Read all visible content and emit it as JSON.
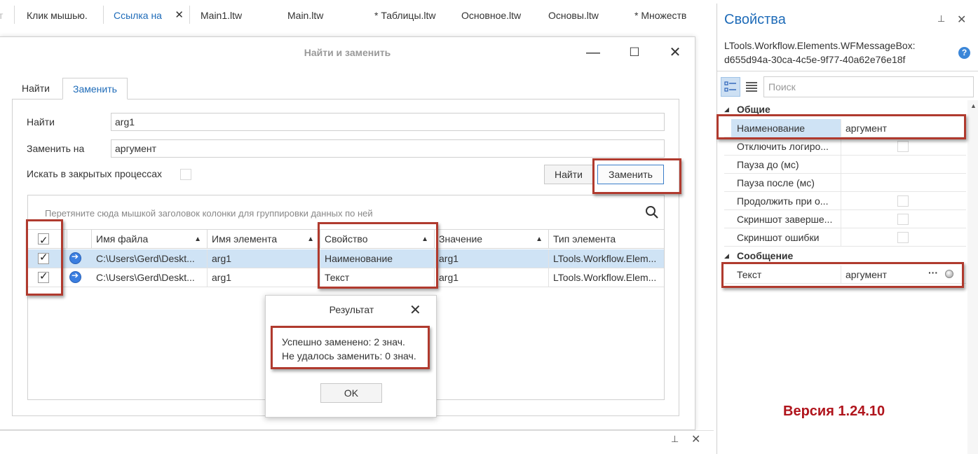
{
  "doc_tabs": {
    "tabs": [
      {
        "label": "т"
      },
      {
        "label": "Клик мышью."
      },
      {
        "label": "Ссылка на"
      },
      {
        "label": "Main1.ltw"
      },
      {
        "label": "Main.ltw"
      },
      {
        "label": "* Таблицы.ltw"
      },
      {
        "label": "Основное.ltw"
      },
      {
        "label": "Основы.ltw"
      },
      {
        "label": "* Множеств"
      }
    ],
    "close_glyph": "✕"
  },
  "dialog": {
    "title": "Найти и заменить",
    "minimize_glyph": "—",
    "maximize_glyph": "☐",
    "close_glyph": "✕",
    "tabs": [
      {
        "label": "Найти"
      },
      {
        "label": "Заменить"
      }
    ],
    "find_label": "Найти",
    "find_value": "arg1",
    "replace_label": "Заменить на",
    "replace_value": "аргумент",
    "search_closed_label": "Искать в закрытых процессах",
    "find_button": "Найти",
    "replace_button": "Заменить",
    "grid": {
      "group_hint": "Перетяните сюда мышкой заголовок колонки для группировки данных по ней",
      "columns": [
        {
          "label": "Имя файла"
        },
        {
          "label": "Имя элемента"
        },
        {
          "label": "Свойство"
        },
        {
          "label": "Значение"
        },
        {
          "label": "Тип элемента"
        }
      ],
      "sort_glyph": "▲",
      "rows": [
        {
          "file": "C:\\Users\\Gerd\\Deskt...",
          "element": "arg1",
          "property": "Наименование",
          "value": "arg1",
          "type": "LTools.Workflow.Elem..."
        },
        {
          "file": "C:\\Users\\Gerd\\Deskt...",
          "element": "arg1",
          "property": "Текст",
          "value": "arg1",
          "type": "LTools.Workflow.Elem..."
        }
      ]
    }
  },
  "result": {
    "title": "Результат",
    "close_glyph": "✕",
    "line1": "Успешно заменено: 2 знач.",
    "line2": "Не удалось заменить: 0 знач.",
    "ok": "OK"
  },
  "bottom": {
    "pin_glyph": "⊥",
    "close_glyph": "✕"
  },
  "properties": {
    "title": "Свойства",
    "pin_glyph": "⊥",
    "close_glyph": "✕",
    "type_line1": "LTools.Workflow.Elements.WFMessageBox:",
    "type_line2": "d655d94a-30ca-4c5e-9f77-40a62e76e18f",
    "help_glyph": "?",
    "search_placeholder": "Поиск",
    "section_general": "Общие",
    "section_message": "Сообщение",
    "general_rows": [
      {
        "name": "Наименование",
        "value": "аргумент"
      },
      {
        "name": "Отключить логиро...",
        "value": ""
      },
      {
        "name": "Пауза до (мс)",
        "value": ""
      },
      {
        "name": "Пауза после (мс)",
        "value": ""
      },
      {
        "name": "Продолжить при о...",
        "value": ""
      },
      {
        "name": "Скриншот заверше...",
        "value": ""
      },
      {
        "name": "Скриншот ошибки",
        "value": ""
      }
    ],
    "message_rows": [
      {
        "name": "Текст",
        "value": "аргумент",
        "ellipsis": "···"
      }
    ],
    "collapse_glyph": "◢",
    "scroll_up_glyph": "▲"
  },
  "version": "Версия 1.24.10"
}
